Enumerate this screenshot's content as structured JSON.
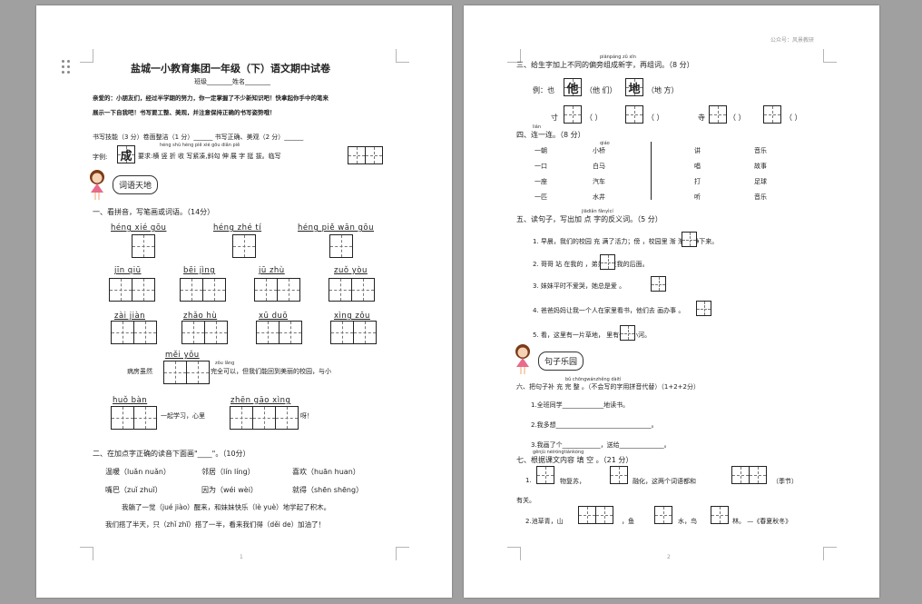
{
  "page1": {
    "title": "盐城一小教育集团一年级（下）语文期中试卷",
    "class_name": "班级________姓名________",
    "intro_line1": "亲爱的：小朋友们，经过半学期的努力，你一定掌握了不少新知识吧！快拿起你手中的笔来",
    "intro_line2": "展示一下自我吧！书写要工整、美观，并注意保持正确的书写姿势哦！",
    "writing_skill": "书写技能（3 分）卷面整洁（1 分）______ 书写正确、美观（2 分）______",
    "char_model_label": "字例:",
    "char_model_char": "成",
    "char_model_py": "héng shù héng piě xié gōu diǎn piě",
    "char_model_text": "要求:横 竖 折 收 写紧凑,斜勾 伸 展 字 挺 拔。临写",
    "badge1": "词语天地",
    "q1_title": "一、看拼音，写笔画或词语。（14分）",
    "q1_py_row1": [
      "héng xié gōu",
      "héng zhé tí",
      "héng piě wān gōu"
    ],
    "q1_py_row2": [
      "jīn qiū",
      "bēi jìng",
      "jū zhù",
      "zuǒ yòu"
    ],
    "q1_py_row3": [
      "zài jiàn",
      "zhǎo hù",
      "xū duō",
      "xìng zǒu"
    ],
    "q1_py_row4": "měi yǒu",
    "q1_sentence1_a": "病房虽然",
    "q1_sentence1_py": "zǒu lǎng",
    "q1_sentence1_b": "完全可以，但我们能回到美丽的校园，与小",
    "q1_py_row5a": "huǒ bàn",
    "q1_py_row5b": "zhēn gāo xìng",
    "q1_sentence2_a": "一起学习，心里",
    "q1_sentence2_b": "呀！",
    "q2_title": "二、在加点字正确的读音下面画\"____\"。（10分）",
    "q2_row1": [
      "温暖（luǎn nuǎn）",
      "邻居（lín líng）",
      "喜欢（huān huan）"
    ],
    "q2_row2": [
      "嘴巴（zuǐ zhuǐ）",
      "因为（wéi wèi）",
      "就得（shēn shēng）"
    ],
    "q2_row3": "我躺了一觉（jué jiào）醒来，和妹妹快乐（lè yuè）地学起了积木。",
    "q2_row4": "我们搭了半天，只（zhǐ zhī）搭了一半，看来我们得（děi de）加油了！",
    "page_number": "1"
  },
  "page2": {
    "header": "公众号：风景教研",
    "q3_title": "三、给生字加上不同的偏旁组成新字，再组词。（8 分）",
    "q3_title_py": "piānpáng zǔ  xīn",
    "q3_example_label": "例：也",
    "q3_example_char1": "他",
    "q3_example_text1": "（他 们）",
    "q3_example_char2": "地",
    "q3_example_text2": "（地 方）",
    "q3_row": [
      "寸",
      "（        ）",
      "（        ）",
      "寺",
      "（        ）",
      "（        ）"
    ],
    "q4_title": "四、连一连。（8 分）",
    "q4_title_py": "lián",
    "q4_left": [
      "一朝",
      "一口",
      "一座",
      "一匹"
    ],
    "q4_middle": [
      "小桥",
      "白马",
      "汽车",
      "水井"
    ],
    "q4_middle_py": "qiáo",
    "q4_right1": [
      "讲",
      "唱",
      "打",
      "听"
    ],
    "q4_right2": [
      "音乐",
      "故事",
      "足球",
      "音乐"
    ],
    "q5_title": "五、读句子，写出加 点 字的反义词。（5 分）",
    "q5_title_py": "jiādiǎn  fǎnyìcí",
    "q5_items": [
      "1. 早晨，我们的校园 充 满了活力；傍          ，校园里 渐 渐 安静下来。",
      "2. 哥哥 站 在我的       ，弟弟站在我的后面。",
      "3. 妹妹平时不爱哭，她总是爱         。",
      "4. 爸爸妈妈让我一个人在家里看书，他们去         画办事 。",
      "5. 看，这里有一片草地，         里有一条小河。"
    ],
    "badge2": "句子乐园",
    "q6_title": "六、把句子补 充 完 整 。（不会写的字用拼音代替）（1+2+2分）",
    "q6_title_py": "bǔ chōngwánzhěng   dàitì",
    "q6_items": [
      "1.全班同学_____________地读书。",
      "2.我多想______________________________。",
      "3.我画了个____________，送给______________。"
    ],
    "q7_title": "七、根据课文内容 填 空 。（21 分）",
    "q7_title_py": "gēnjù  nèiróngtiánkòng",
    "q7_row1_a": "1.",
    "q7_row1_b": "物复苏，",
    "q7_row1_c": "融化，这两个词语都和",
    "q7_row1_d": "（季节）",
    "q7_row1_e": "有关。",
    "q7_row2_a": "2.池草青，山",
    "q7_row2_b": "，鱼",
    "q7_row2_c": "水，鸟",
    "q7_row2_d": "林。 —《春夏秋冬》",
    "page_number": "2"
  }
}
